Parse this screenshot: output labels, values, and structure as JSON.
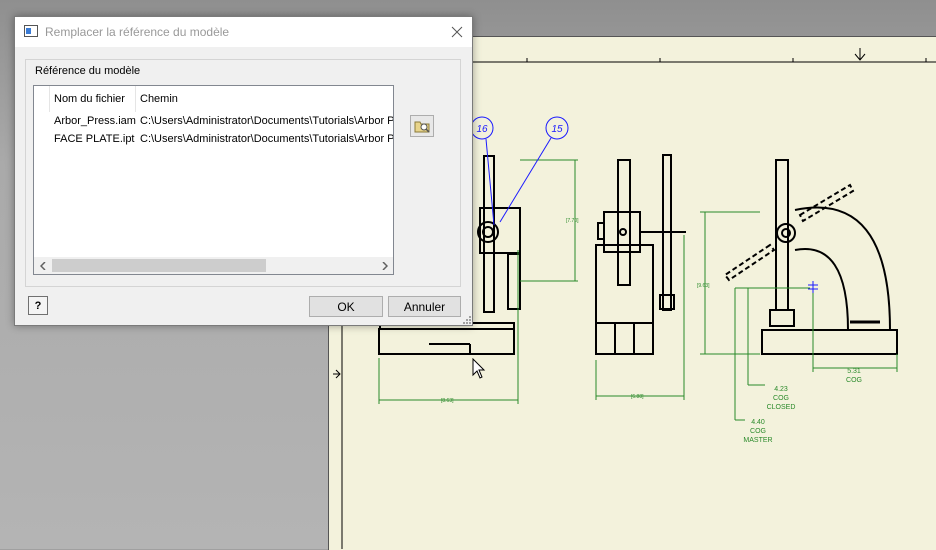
{
  "dialog": {
    "title": "Remplacer la référence du modèle",
    "group_label": "Référence du modèle",
    "columns": [
      "Nom du fichier",
      "Chemin"
    ],
    "rows": [
      {
        "name": "Arbor_Press.iam",
        "path": "C:\\Users\\Administrator\\Documents\\Tutorials\\Arbor P"
      },
      {
        "name": "FACE PLATE.ipt",
        "path": "C:\\Users\\Administrator\\Documents\\Tutorials\\Arbor P"
      }
    ],
    "ok_label": "OK",
    "cancel_label": "Annuler",
    "help_label": "?",
    "icons": {
      "close": "close-icon",
      "browse": "browse-folder-icon",
      "help": "help-icon",
      "app": "dialog-app-icon"
    }
  },
  "drawing": {
    "balloons": [
      "16",
      "15"
    ],
    "dimensions": [
      "[8.63]",
      "[7.70]",
      "[6.88]",
      "[9.63]"
    ],
    "annotations": [
      {
        "value": "4.23",
        "lines": [
          "COG",
          "CLOSED"
        ]
      },
      {
        "value": "4.40",
        "lines": [
          "COG",
          "MASTER"
        ]
      },
      {
        "value": "5.31",
        "lines": [
          "COG"
        ]
      }
    ],
    "colors": {
      "sheet": "#f3f2dc",
      "linework": "#000000",
      "dimension": "#2a8a2a",
      "balloon": "#1a1aff"
    }
  }
}
